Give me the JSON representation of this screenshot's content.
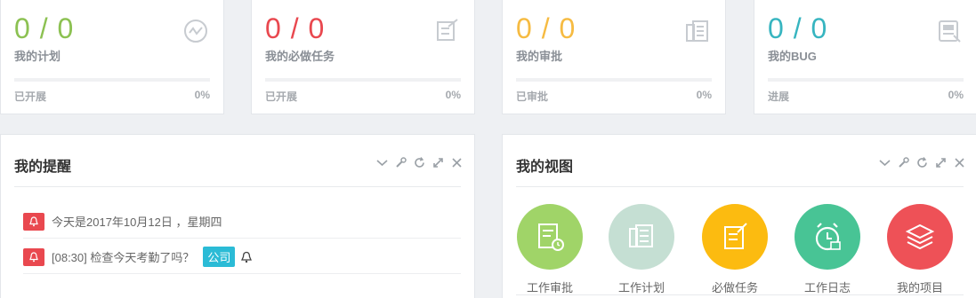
{
  "stats": [
    {
      "value": "0 / 0",
      "label": "我的计划",
      "footer": "已开展",
      "percent": "0%",
      "progress": 0,
      "color": "#8cc152",
      "icon": "pulse-icon"
    },
    {
      "value": "0 / 0",
      "label": "我的必做任务",
      "footer": "已开展",
      "percent": "0%",
      "progress": 0,
      "color": "#e9484f",
      "icon": "edit-icon"
    },
    {
      "value": "0 / 0",
      "label": "我的审批",
      "footer": "已审批",
      "percent": "0%",
      "progress": 0,
      "color": "#f6bb42",
      "icon": "document-icon"
    },
    {
      "value": "0 / 0",
      "label": "我的BUG",
      "footer": "进展",
      "percent": "0%",
      "progress": 0,
      "color": "#37bc9b",
      "icon": "bug-icon"
    }
  ],
  "reminder_panel": {
    "title": "我的提醒",
    "items": [
      {
        "text": "今天是2017年10月12日 ，星期四"
      },
      {
        "text": "[08:30] 检查今天考勤了吗？",
        "tag": "公司"
      }
    ]
  },
  "view_panel": {
    "title": "我的视图",
    "items": [
      {
        "label": "工作审批",
        "color": "#a0d468",
        "icon": "approval-icon"
      },
      {
        "label": "工作计划",
        "color": "#c5dfd3",
        "icon": "plan-icon"
      },
      {
        "label": "必做任务",
        "color": "#fcbb10",
        "icon": "task-icon"
      },
      {
        "label": "工作日志",
        "color": "#48c495",
        "icon": "alarm-clock-icon"
      },
      {
        "label": "我的项目",
        "color": "#ee5157",
        "icon": "layers-icon"
      }
    ]
  }
}
